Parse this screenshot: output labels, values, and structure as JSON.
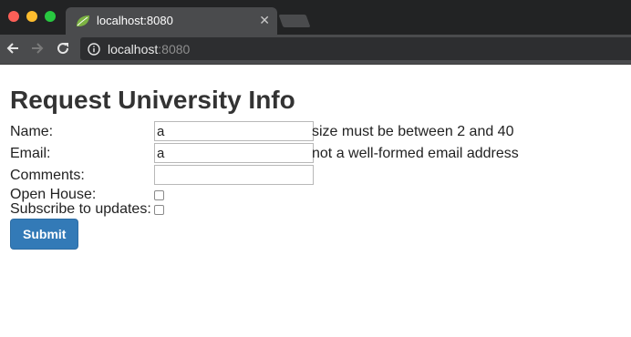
{
  "browser": {
    "tab_title": "localhost:8080",
    "tab_close": "✕",
    "url_host": "localhost",
    "url_port": ":8080"
  },
  "page": {
    "title": "Request University Info",
    "fields": {
      "name": {
        "label": "Name:",
        "value": "a",
        "error": "size must be between 2 and 40"
      },
      "email": {
        "label": "Email:",
        "value": "a",
        "error": "not a well-formed email address"
      },
      "comments": {
        "label": "Comments:",
        "value": ""
      }
    },
    "checkboxes": {
      "open_house": {
        "label": "Open House:",
        "checked": false
      },
      "subscribe": {
        "label": "Subscribe to updates:",
        "checked": false
      }
    },
    "submit_label": "Submit"
  },
  "colors": {
    "button_bg": "#337ab7",
    "tab_bg": "#4a4b4d",
    "tabbar_bg": "#222324"
  }
}
